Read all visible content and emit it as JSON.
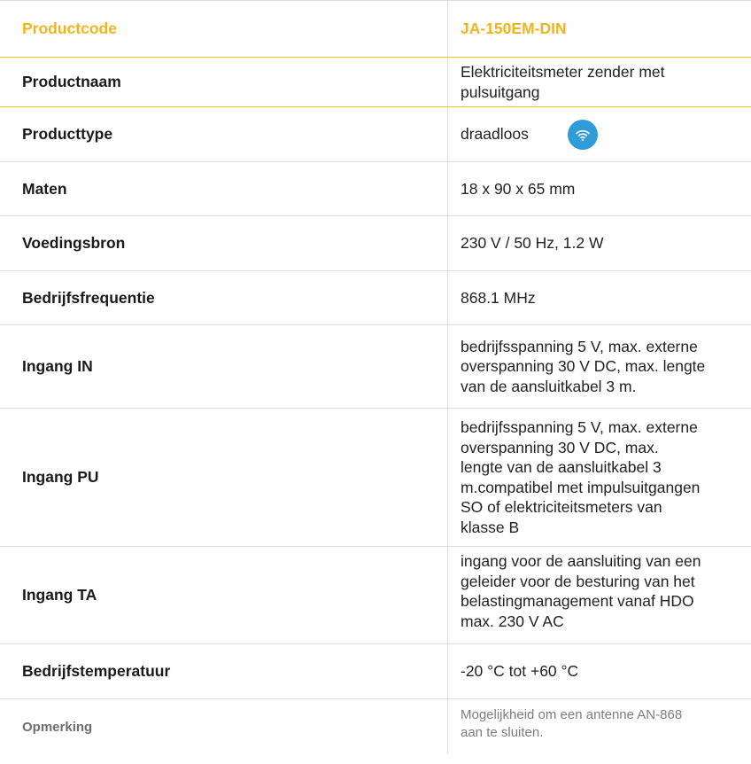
{
  "rows": [
    {
      "label": "Productcode",
      "value": "JA-150EM-DIN"
    },
    {
      "label": "Productnaam",
      "value": "Elektriciteitsmeter zender met\npulsuitgang"
    },
    {
      "label": "Producttype",
      "value": "draadloos",
      "icon": "wifi-icon"
    },
    {
      "label": "Maten",
      "value": "18 x 90 x 65 mm"
    },
    {
      "label": "Voedingsbron",
      "value": "230 V / 50 Hz, 1.2 W"
    },
    {
      "label": "Bedrijfsfrequentie",
      "value": "868.1 MHz"
    },
    {
      "label": "Ingang IN",
      "value": "bedrijfsspanning 5 V, max. externe\noverspanning 30 V DC, max. lengte\nvan de aansluitkabel 3 m."
    },
    {
      "label": "Ingang PU",
      "value": "bedrijfsspanning 5 V, max. externe\noverspanning 30 V DC, max.\nlengte van de aansluitkabel 3\nm.compatibel met impulsuitgangen\nSO of elektriciteitsmeters van\nklasse B"
    },
    {
      "label": "Ingang TA",
      "value": "ingang voor de aansluiting van een\ngeleider voor de besturing van het\nbelastingmanagement vanaf HDO\nmax. 230 V AC"
    },
    {
      "label": "Bedrijfstemperatuur",
      "value": "-20 °C tot +60 °C"
    },
    {
      "label": "Opmerking",
      "value": "Mogelijkheid om een antenne AN-868\naan te sluiten."
    }
  ],
  "colors": {
    "accent": "#f0b41e",
    "wifi_badge": "#2f9bd8",
    "divider": "#dcdcdc"
  }
}
